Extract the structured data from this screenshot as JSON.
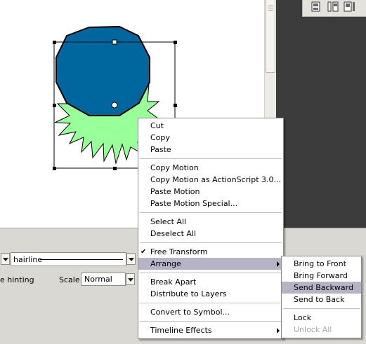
{
  "properties": {
    "stroke_style": "hairline",
    "hinting_label": "e hinting",
    "scale_label": "Scale:",
    "scale_value": "Normal"
  },
  "toolbar_icons": [
    "align-left-icon",
    "align-center-icon",
    "align-right-icon"
  ],
  "context_menu": {
    "cut": "Cut",
    "copy": "Copy",
    "paste": "Paste",
    "copy_motion": "Copy Motion",
    "copy_motion_as": "Copy Motion as ActionScript 3.0...",
    "paste_motion": "Paste Motion",
    "paste_motion_special": "Paste Motion Special...",
    "select_all": "Select All",
    "deselect_all": "Deselect All",
    "free_transform": "Free Transform",
    "free_transform_checked": true,
    "arrange": "Arrange",
    "break_apart": "Break Apart",
    "distribute_to_layers": "Distribute to Layers",
    "convert_to_symbol": "Convert to Symbol...",
    "timeline_effects": "Timeline Effects"
  },
  "arrange_submenu": {
    "bring_to_front": "Bring to Front",
    "bring_forward": "Bring Forward",
    "send_backward": "Send Backward",
    "send_to_back": "Send to Back",
    "lock": "Lock",
    "unlock_all": "Unlock All"
  },
  "colors": {
    "polygon_fill": "#00679e",
    "starburst_fill": "#99ff99",
    "menu_highlight": "#b7b3c6",
    "panel_bg": "#d9d8d3",
    "dark_panel": "#3c3c3c"
  }
}
